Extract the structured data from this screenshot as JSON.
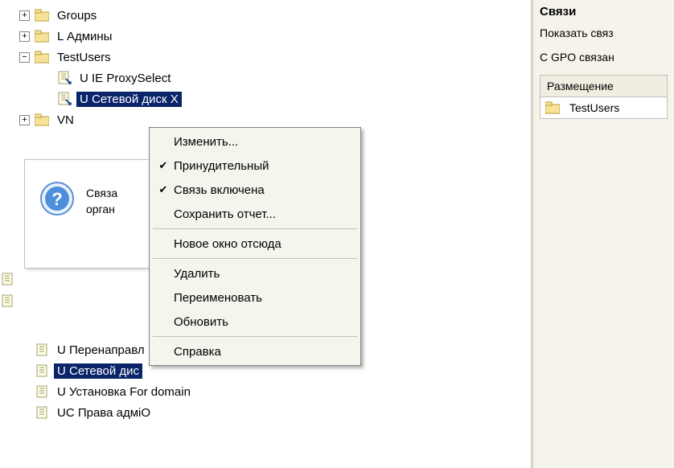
{
  "tree": {
    "groups": "Groups",
    "l_admins": "L Админы",
    "testusers": "TestUsers",
    "u_ie_proxy": "U IE ProxySelect",
    "u_net_disk": "U Сетевой диск X",
    "vn": "VN"
  },
  "lower": {
    "u_redirect": "U Перенаправл",
    "u_netdisk": "U Сетевой дис",
    "u_install_domain": "U Установка For domain",
    "uc_rights_admin": "UC Права адмiO"
  },
  "info": {
    "line1": "Связа",
    "line2": "орган"
  },
  "right": {
    "title": "Связи",
    "show": "Показать связ",
    "gpo_links": "С GPO связан",
    "col_header": "Размещение",
    "row1": "TestUsers"
  },
  "menu": {
    "edit": "Изменить...",
    "enforced": "Принудительный",
    "link_enabled": "Связь включена",
    "save_report": "Сохранить отчет...",
    "new_window": "Новое окно отсюда",
    "delete": "Удалить",
    "rename": "Переименовать",
    "refresh": "Обновить",
    "help": "Справка"
  }
}
